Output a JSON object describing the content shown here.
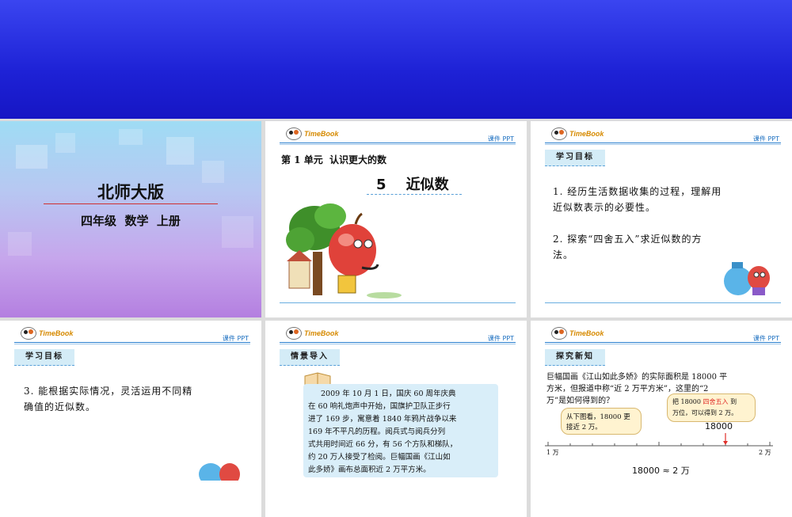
{
  "header": {
    "logo_text": "TimeBook",
    "ppt_label": "课件 PPT"
  },
  "slide1": {
    "publisher": "北师大版",
    "subtitle": "四年级  数学  上册"
  },
  "slide2": {
    "unit": "第 1 单元  认识更大的数",
    "lesson": "5    近似数"
  },
  "slide3": {
    "badge": "学习目标",
    "goal1_line1": "1. 经历生活数据收集的过程，理解用",
    "goal1_line2": "近似数表示的必要性。",
    "goal2_line1": "2. 探索“四舍五入”求近似数的方",
    "goal2_line2": "法。"
  },
  "slide4": {
    "badge": "学习目标",
    "goal3_line1": "3. 能根据实际情况，灵活运用不同精",
    "goal3_line2": "确值的近似数。"
  },
  "slide5": {
    "badge": "情景导入",
    "lines": [
      "2009 年 10 月 1 日，国庆 60 周年庆典",
      "在 60 响礼炮声中开始，国旗护卫队正步行",
      "进了 169 步，寓意着 1840 年鸦片战争以来",
      "169 年不平凡的历程。阅兵式与阅兵分列",
      "式共用时间近 66 分，有 56 个方队和梯队，",
      "约 20 万人接受了检阅。巨幅国画《江山如",
      "此多娇》画布总面积近 2 万平方米。"
    ]
  },
  "slide6": {
    "badge": "探究新知",
    "q_line1": "巨幅国画《江山如此多娇》的实际面积是 18000 平",
    "q_line2": "方米，但报道中称“近 2 万平方米”，这里的“2",
    "q_line3": "万”是如何得到的？",
    "bubble_left_1": "从下图看，18000 更",
    "bubble_left_2": "接近 2 万。",
    "bubble_right_1": "把 18000",
    "bubble_right_highlight": "四舍五入",
    "bubble_right_1b": "到",
    "bubble_right_2": "万位，可以得到 2 万。",
    "marker_value": "18000",
    "axis_start": "1 万",
    "axis_end": "2 万",
    "result": "18000 ≈ 2 万",
    "highlight_color": "#e0302a"
  }
}
